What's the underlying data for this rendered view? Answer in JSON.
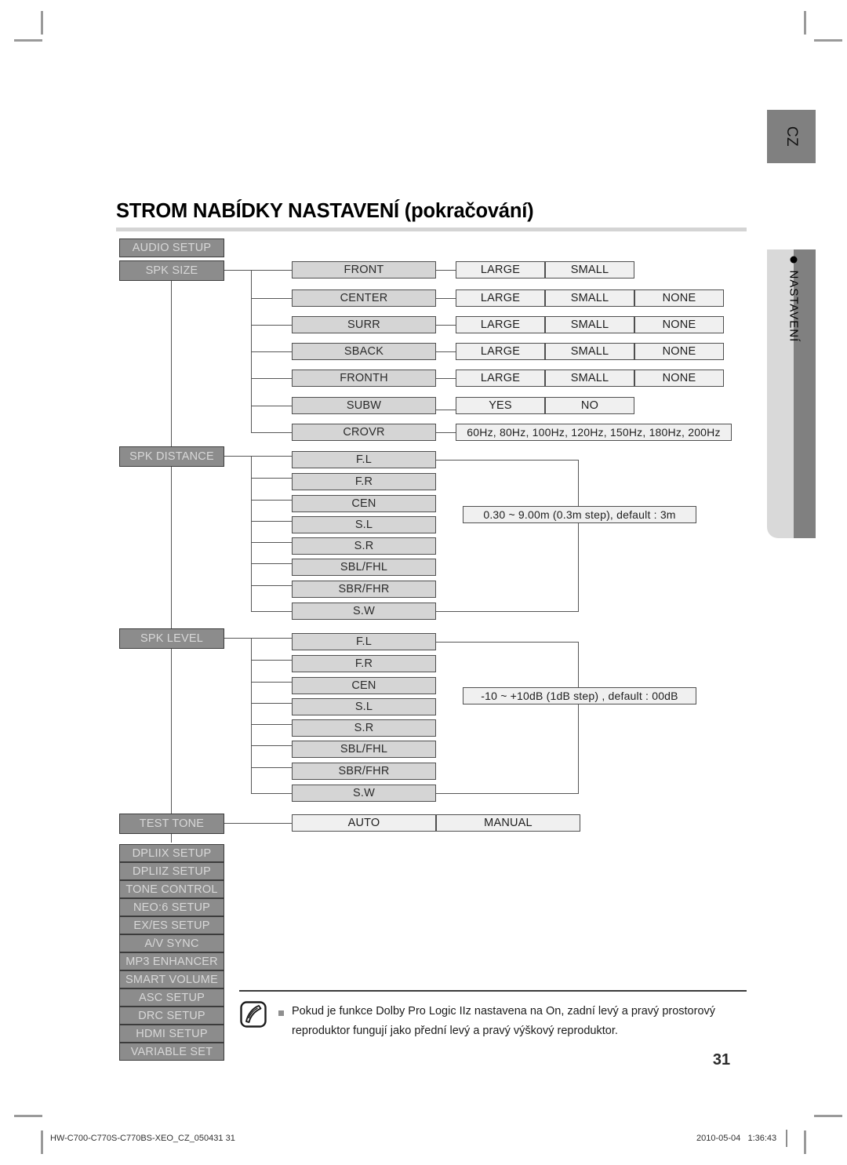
{
  "document": {
    "title": "STROM NABÍDKY NASTAVENÍ (pokračování)",
    "page_number": "31",
    "language_tab": "CZ",
    "side_tab_label": "NASTAVENÍ"
  },
  "footer": {
    "left": "HW-C700-C770S-C770BS-XEO_CZ_050431   31",
    "date": "2010-05-04",
    "time": "1:36:43"
  },
  "note": {
    "text": "Pokud je funkce Dolby Pro Logic IIz nastavena na On, zadní levý a pravý prostorový reproduktor fungují jako přední levý a pravý výškový reproduktor.",
    "icon": "note-hand-icon"
  },
  "colors": {
    "category_box": "#8c8c8c",
    "mid_box": "#d5d5d5",
    "option_box": "#f0f0f0",
    "tab": "#808080",
    "rule": "#d4d4d4"
  },
  "tree": {
    "root_label": "AUDIO SETUP",
    "categories": [
      {
        "label": "SPK SIZE"
      },
      {
        "label": "SPK DISTANCE"
      },
      {
        "label": "SPK LEVEL"
      },
      {
        "label": "TEST TONE"
      }
    ],
    "spk_size": {
      "rows": [
        {
          "name": "FRONT",
          "options": [
            "LARGE",
            "SMALL"
          ]
        },
        {
          "name": "CENTER",
          "options": [
            "LARGE",
            "SMALL",
            "NONE"
          ]
        },
        {
          "name": "SURR",
          "options": [
            "LARGE",
            "SMALL",
            "NONE"
          ]
        },
        {
          "name": "SBACK",
          "options": [
            "LARGE",
            "SMALL",
            "NONE"
          ]
        },
        {
          "name": "FRONTH",
          "options": [
            "LARGE",
            "SMALL",
            "NONE"
          ]
        },
        {
          "name": "SUBW",
          "options": [
            "YES",
            "NO"
          ]
        },
        {
          "name": "CROVR",
          "range": "60Hz, 80Hz, 100Hz, 120Hz, 150Hz, 180Hz, 200Hz"
        }
      ]
    },
    "spk_distance": {
      "items": [
        "F.L",
        "F.R",
        "CEN",
        "S.L",
        "S.R",
        "SBL/FHL",
        "SBR/FHR",
        "S.W"
      ],
      "range": "0.30 ~ 9.00m (0.3m step), default : 3m"
    },
    "spk_level": {
      "items": [
        "F.L",
        "F.R",
        "CEN",
        "S.L",
        "S.R",
        "SBL/FHL",
        "SBR/FHR",
        "S.W"
      ],
      "range": "-10 ~ +10dB (1dB step) , default : 00dB"
    },
    "test_tone": {
      "options": [
        "AUTO",
        "MANUAL"
      ]
    },
    "other_categories": [
      "DPLIIX SETUP",
      "DPLIIZ SETUP",
      "TONE CONTROL",
      "NEO:6 SETUP",
      "EX/ES SETUP",
      "A/V SYNC",
      "MP3 ENHANCER",
      "SMART VOLUME",
      "ASC SETUP",
      "DRC SETUP",
      "HDMI SETUP",
      "VARIABLE SET"
    ]
  }
}
